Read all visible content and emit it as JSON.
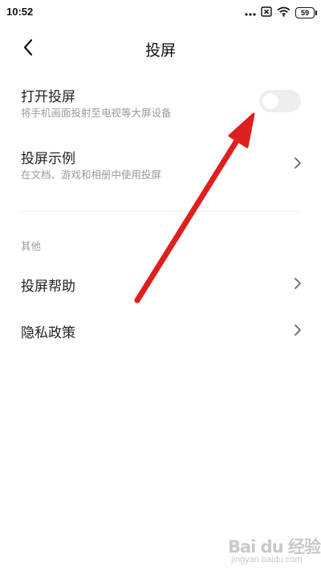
{
  "status_bar": {
    "time": "10:52",
    "battery": "59",
    "icons": [
      "more-dots-icon",
      "sim-x-icon",
      "wifi-icon",
      "battery-icon"
    ]
  },
  "header": {
    "title": "投屏",
    "back_icon": "chevron-left-icon"
  },
  "settings": {
    "cast_toggle": {
      "title": "打开投屏",
      "subtitle": "将手机画面投射至电视等大屏设备",
      "enabled": false
    },
    "cast_example": {
      "title": "投屏示例",
      "subtitle": "在文档、游戏和相册中使用投屏"
    },
    "other_section": {
      "label": "其他",
      "items": [
        {
          "title": "投屏帮助"
        },
        {
          "title": "隐私政策"
        }
      ]
    }
  },
  "annotation": {
    "arrow_color": "#e01e1e"
  },
  "watermark": {
    "brand": "Bai du 经验",
    "url": "jingyan.baidu.com"
  }
}
